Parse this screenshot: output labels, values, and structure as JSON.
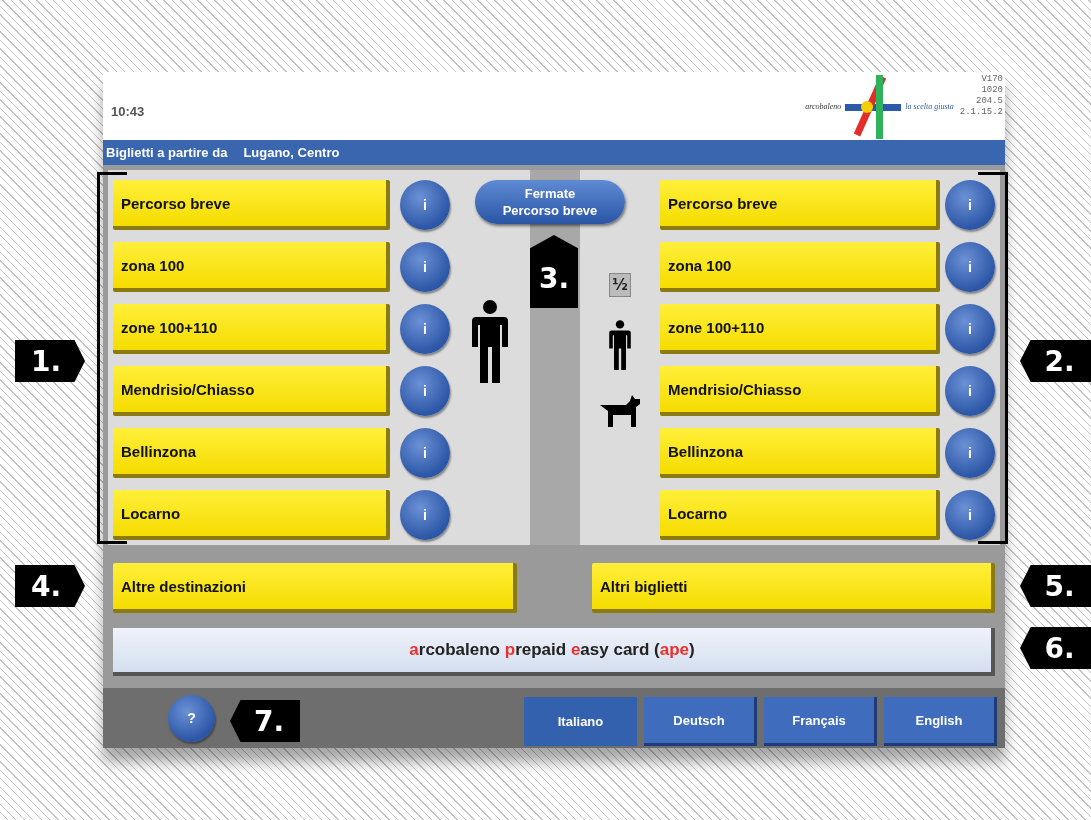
{
  "header": {
    "time": "10:43",
    "logo_left": "arcobaleno",
    "logo_right": "la scelta giusta",
    "version_lines": [
      "V170",
      "1020",
      "204.5",
      "2.1.15.2"
    ]
  },
  "title_bar": {
    "label": "Biglietti a partire da",
    "origin": "Lugano, Centro"
  },
  "adult_tickets": [
    {
      "label": "Percorso breve",
      "info": "i"
    },
    {
      "label": "zona 100",
      "info": "i"
    },
    {
      "label": "zone 100+110",
      "info": "i"
    },
    {
      "label": "Mendrisio/Chiasso",
      "info": "i"
    },
    {
      "label": "Bellinzona",
      "info": "i"
    },
    {
      "label": "Locarno",
      "info": "i"
    }
  ],
  "stops_button": [
    "Fermate",
    "Percorso breve"
  ],
  "reduced_badge": "½",
  "reduced_tickets": [
    {
      "label": "Percorso breve",
      "info": "i"
    },
    {
      "label": "zona 100",
      "info": "i"
    },
    {
      "label": "zone 100+110",
      "info": "i"
    },
    {
      "label": "Mendrisio/Chiasso",
      "info": "i"
    },
    {
      "label": "Bellinzona",
      "info": "i"
    },
    {
      "label": "Locarno",
      "info": "i"
    }
  ],
  "other_destinations": "Altre destinazioni",
  "other_tickets": "Altri biglietti",
  "ape_card": [
    {
      "text": "a",
      "accent": true
    },
    {
      "text": "rcobaleno ",
      "accent": false
    },
    {
      "text": "p",
      "accent": true
    },
    {
      "text": "repaid ",
      "accent": false
    },
    {
      "text": "e",
      "accent": true
    },
    {
      "text": "asy card (",
      "accent": false
    },
    {
      "text": "ape",
      "accent": true
    },
    {
      "text": ")",
      "accent": false
    }
  ],
  "help_button": "?",
  "languages": [
    {
      "label": "Italiano",
      "selected": true
    },
    {
      "label": "Deutsch",
      "selected": false
    },
    {
      "label": "Français",
      "selected": false
    },
    {
      "label": "English",
      "selected": false
    }
  ],
  "callouts": [
    {
      "label": "1.",
      "kind": "right"
    },
    {
      "label": "2.",
      "kind": "left"
    },
    {
      "label": "3.",
      "kind": "up"
    },
    {
      "label": "4.",
      "kind": "right"
    },
    {
      "label": "5.",
      "kind": "left"
    },
    {
      "label": "6.",
      "kind": "left"
    },
    {
      "label": "7.",
      "kind": "left"
    }
  ]
}
